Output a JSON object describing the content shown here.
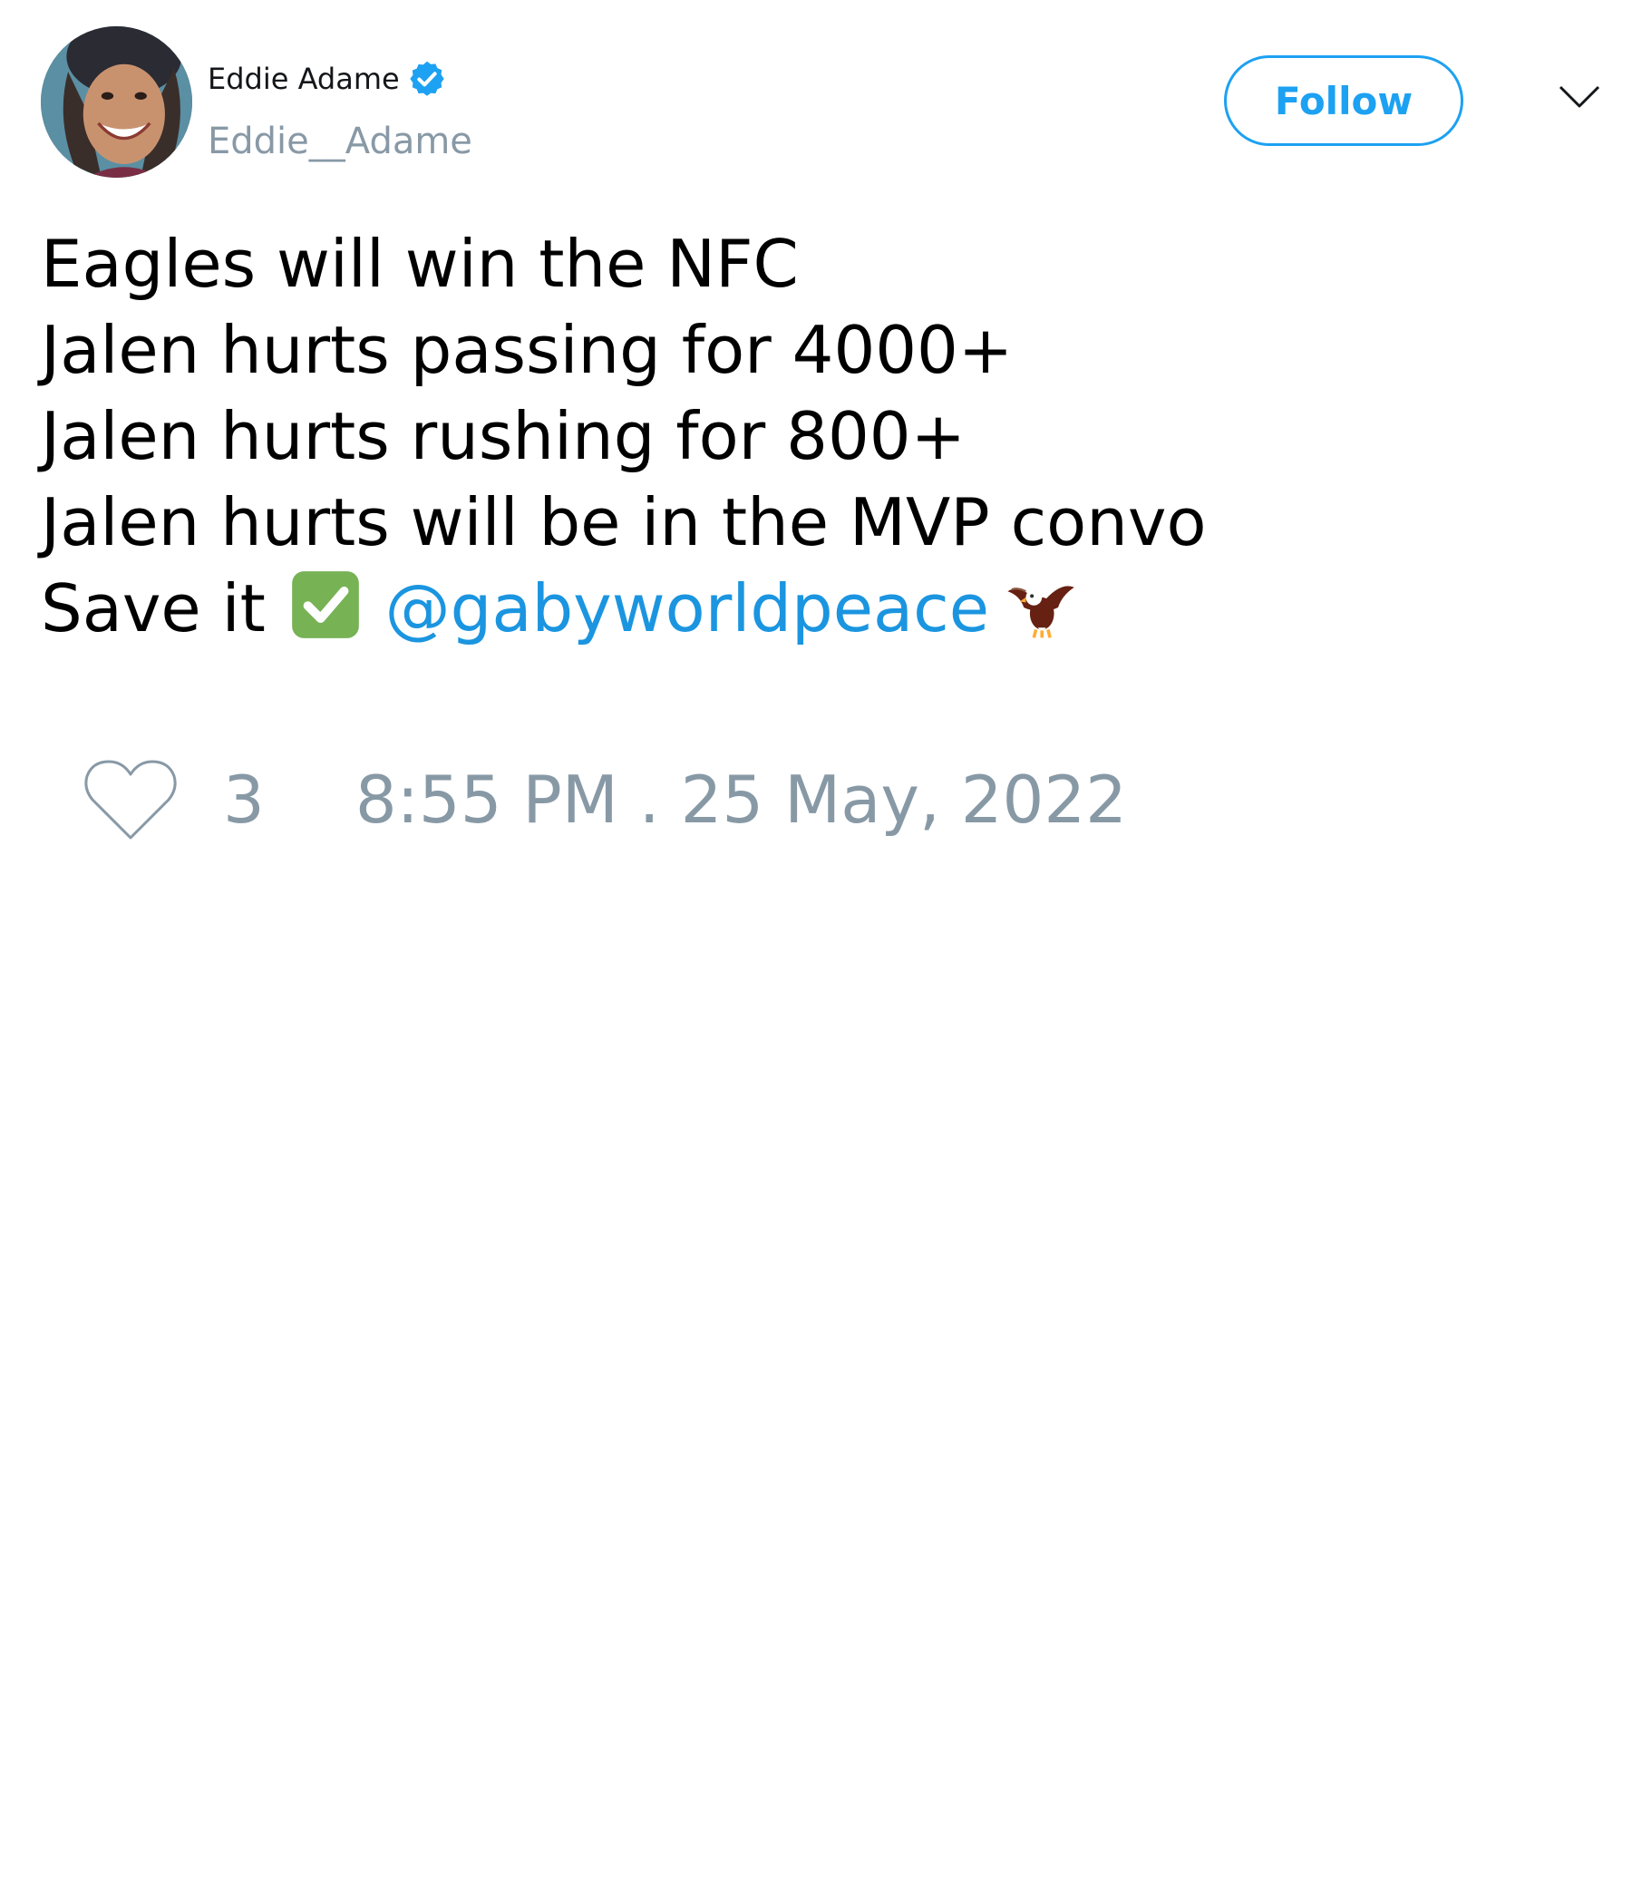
{
  "author": {
    "display_name": "Eddie Adame",
    "handle": "Eddie__Adame",
    "verified": true,
    "avatar_icon": "profile-photo-avatar"
  },
  "header": {
    "follow_label": "Follow",
    "menu_icon": "chevron-down-icon"
  },
  "tweet": {
    "lines": [
      "Eagles will win the NFC",
      "Jalen hurts passing for 4000+",
      "Jalen hurts rushing for 800+",
      "Jalen hurts will be in the MVP convo"
    ],
    "last_line_prefix": "Save it ",
    "check_emoji_icon": "check-mark-button-emoji",
    "mention": "@gabyworldpeace",
    "eagle_emoji_icon": "eagle-emoji"
  },
  "footer": {
    "heart_icon": "heart-icon",
    "like_count": "3",
    "timestamp": "8:55 PM . 25 May, 2022"
  },
  "colors": {
    "accent": "#1da1f2",
    "mention": "#1b95e0",
    "muted": "#8899a6",
    "text": "#000000"
  }
}
